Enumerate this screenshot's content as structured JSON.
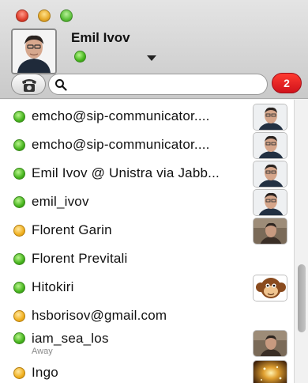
{
  "account": {
    "name": "Emil Ivov",
    "status": "online"
  },
  "search": {
    "placeholder": "",
    "value": ""
  },
  "unread_badge": "2",
  "contacts": [
    {
      "name": "emcho@sip-communicator....",
      "status": "online",
      "sub": "",
      "avatar": "face"
    },
    {
      "name": "emcho@sip-communicator....",
      "status": "online",
      "sub": "",
      "avatar": "face"
    },
    {
      "name": "Emil Ivov @ Unistra via Jabb...",
      "status": "online",
      "sub": "",
      "avatar": "face"
    },
    {
      "name": "emil_ivov",
      "status": "online",
      "sub": "",
      "avatar": "face"
    },
    {
      "name": "Florent Garin",
      "status": "away",
      "sub": "",
      "avatar": "face-dark"
    },
    {
      "name": "Florent Previtali",
      "status": "online",
      "sub": "",
      "avatar": ""
    },
    {
      "name": "Hitokiri",
      "status": "online",
      "sub": "",
      "avatar": "monkey"
    },
    {
      "name": "hsborisov@gmail.com",
      "status": "away",
      "sub": "",
      "avatar": ""
    },
    {
      "name": "iam_sea_los",
      "status": "online",
      "sub": "Away",
      "avatar": "face-dark"
    },
    {
      "name": "Ingo",
      "status": "away",
      "sub": "",
      "avatar": "sparkle"
    }
  ],
  "colors": {
    "online": "#47b51e",
    "away": "#f0b020",
    "badge": "#e0141e"
  },
  "icons": {
    "phone": "phone-icon",
    "search": "search-icon",
    "status_menu": "chevron-down-icon"
  }
}
